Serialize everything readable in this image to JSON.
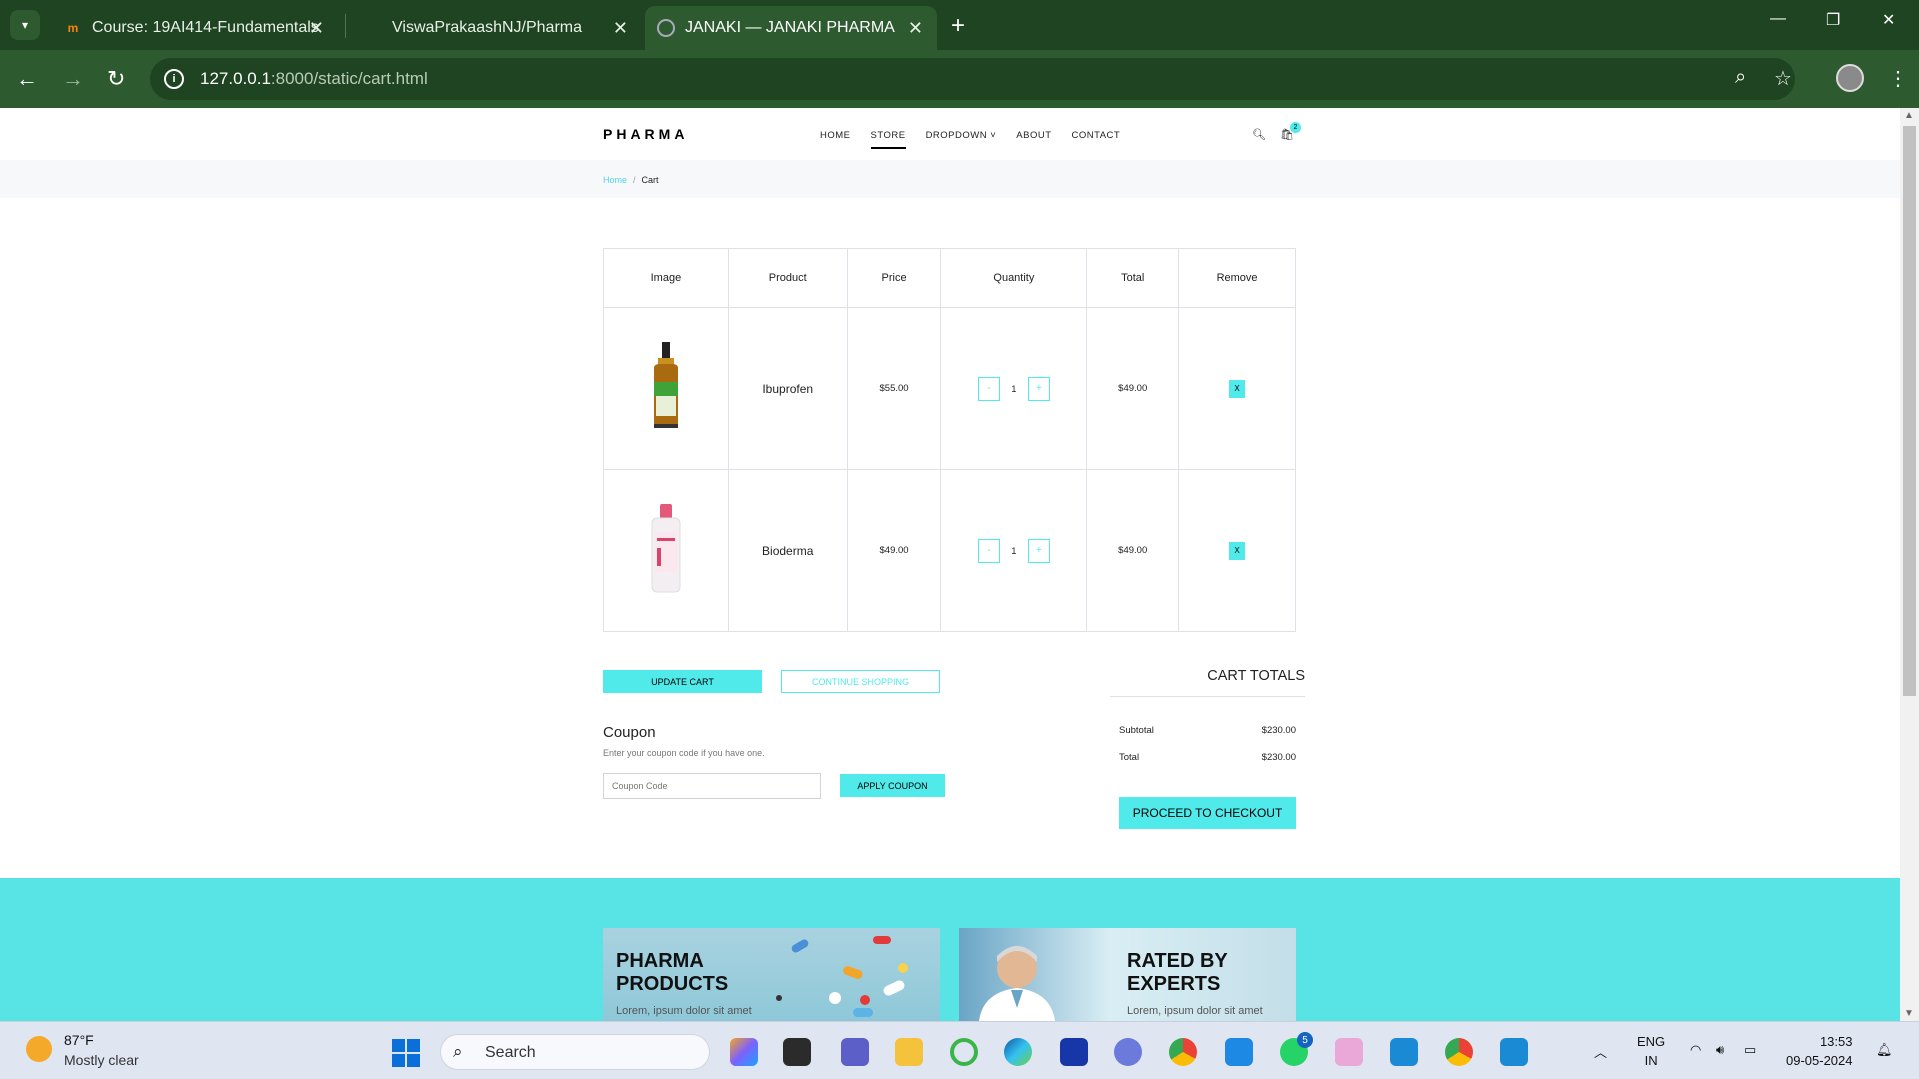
{
  "browser": {
    "tabs": [
      {
        "title": "Course: 19AI414-Fundamentals",
        "favicon": "moodle-icon"
      },
      {
        "title": "ViswaPrakaashNJ/Pharma",
        "favicon": "github-icon"
      },
      {
        "title": "JANAKI — JANAKI PHARMA",
        "favicon": "globe-icon"
      }
    ],
    "url_host": "127.0.0.1",
    "url_path": ":8000/static/cart.html"
  },
  "site": {
    "logo": "PHARMA",
    "nav": [
      "HOME",
      "STORE",
      "DROPDOWN",
      "ABOUT",
      "CONTACT"
    ],
    "active_nav": "STORE",
    "cart_count": "2"
  },
  "breadcrumb": {
    "home": "Home",
    "separator": "/",
    "current": "Cart"
  },
  "cart": {
    "headers": [
      "Image",
      "Product",
      "Price",
      "Quantity",
      "Total",
      "Remove"
    ],
    "rows": [
      {
        "product": "Ibuprofen",
        "price": "$55.00",
        "qty": "1",
        "total": "$49.00",
        "remove": "X",
        "minus": "-",
        "plus": "+"
      },
      {
        "product": "Bioderma",
        "price": "$49.00",
        "qty": "1",
        "total": "$49.00",
        "remove": "X",
        "minus": "-",
        "plus": "+"
      }
    ]
  },
  "actions": {
    "update": "UPDATE CART",
    "continue": "CONTINUE SHOPPING"
  },
  "coupon": {
    "title": "Coupon",
    "help": "Enter your coupon code if you have one.",
    "placeholder": "Coupon Code",
    "apply": "APPLY COUPON"
  },
  "totals": {
    "title": "CART TOTALS",
    "subtotal_label": "Subtotal",
    "subtotal": "$230.00",
    "total_label": "Total",
    "total": "$230.00",
    "checkout": "PROCEED TO CHECKOUT"
  },
  "promos": [
    {
      "title_line1": "PHARMA",
      "title_line2": "PRODUCTS",
      "sub": "Lorem, ipsum dolor sit amet"
    },
    {
      "title_line1": "RATED BY",
      "title_line2": "EXPERTS",
      "sub": "Lorem, ipsum dolor sit amet"
    }
  ],
  "taskbar": {
    "temp": "87°F",
    "weather": "Mostly clear",
    "search": "Search",
    "lang1": "ENG",
    "lang2": "IN",
    "time": "13:53",
    "date": "09-05-2024",
    "whatsapp_badge": "5"
  },
  "colors": {
    "accent": "#51eaea",
    "chrome": "#2e5a30"
  }
}
